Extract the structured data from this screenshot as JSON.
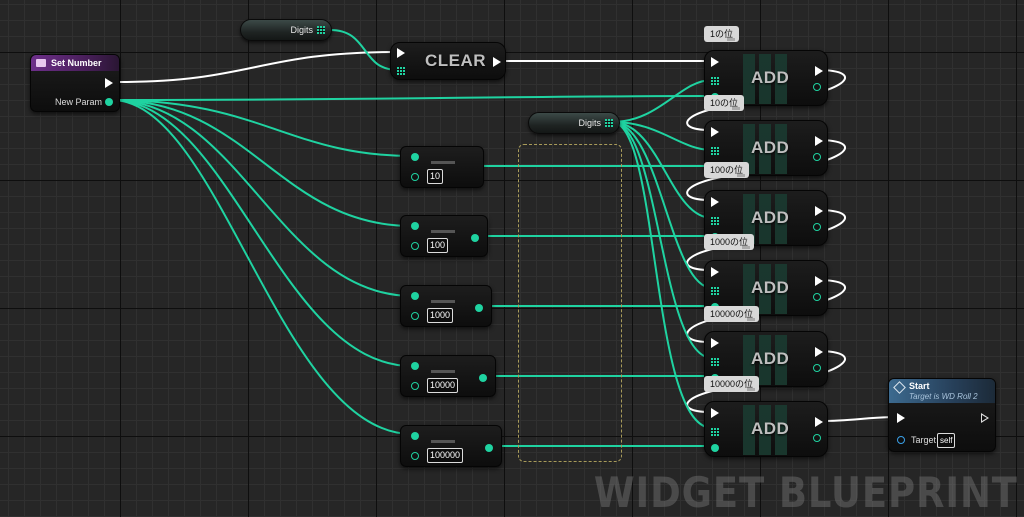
{
  "watermark": "WIDGET BLUEPRINT",
  "colors": {
    "wire": "#1fd3a1",
    "exec_wire": "#ffffff",
    "event_header": "#6d2f8a",
    "function_header": "#3c6a8f"
  },
  "set_number": {
    "title": "Set Number",
    "param_label": "New Param"
  },
  "digits_var_1": {
    "label": "Digits",
    "icon": "array-grid-icon"
  },
  "digits_var_2": {
    "label": "Digits",
    "icon": "array-grid-icon"
  },
  "clear_node": {
    "label": "CLEAR"
  },
  "math_nodes": [
    {
      "value": "10"
    },
    {
      "value": "100"
    },
    {
      "value": "1000"
    },
    {
      "value": "10000"
    },
    {
      "value": "100000"
    }
  ],
  "add_nodes": [
    {
      "label": "ADD",
      "comment": "1の位"
    },
    {
      "label": "ADD",
      "comment": "10の位"
    },
    {
      "label": "ADD",
      "comment": "100の位"
    },
    {
      "label": "ADD",
      "comment": "1000の位"
    },
    {
      "label": "ADD",
      "comment": "10000の位"
    },
    {
      "label": "ADD",
      "comment": "10000の位"
    }
  ],
  "start_node": {
    "title": "Start",
    "subtitle": "Target is WD Roll 2",
    "target_label": "Target",
    "target_value": "self"
  }
}
